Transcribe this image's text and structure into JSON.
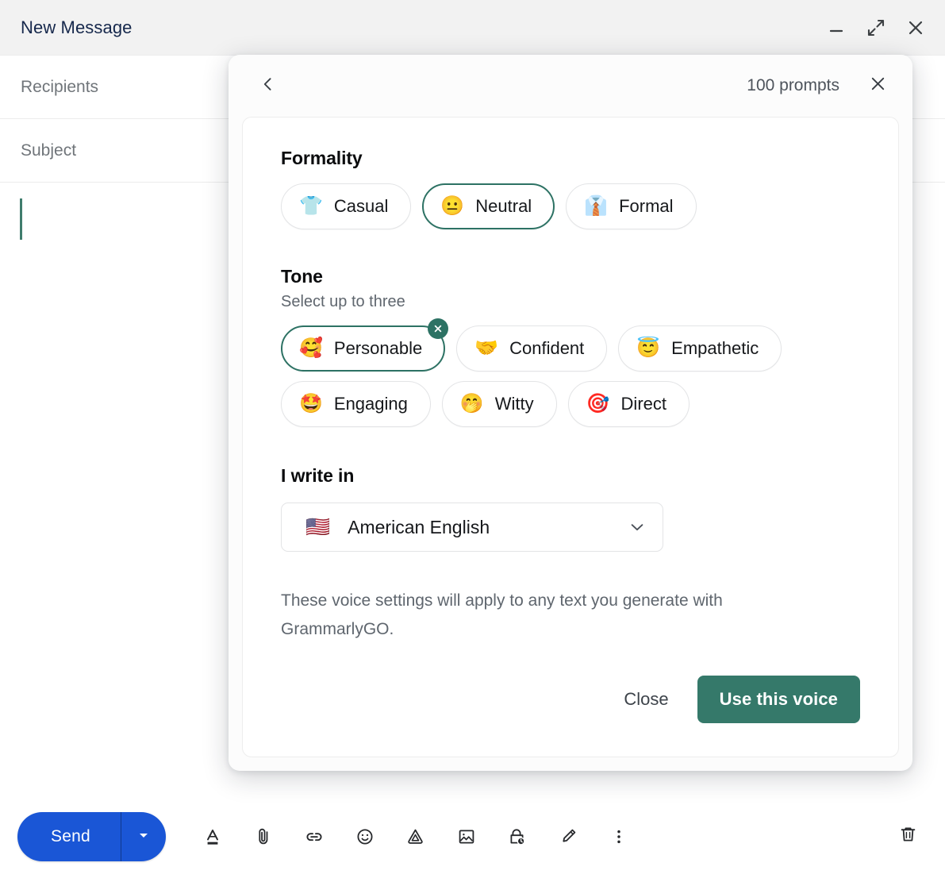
{
  "compose": {
    "title": "New Message",
    "window_controls": [
      {
        "name": "minimize",
        "icon": "minimize-icon"
      },
      {
        "name": "expand",
        "icon": "expand-icon"
      },
      {
        "name": "close",
        "icon": "close-icon"
      }
    ],
    "recipients_placeholder": "Recipients",
    "subject_placeholder": "Subject",
    "body_value": "",
    "toolbar": {
      "send_label": "Send",
      "send_options_icon": "chevron-down-icon",
      "icons": [
        "formatting-options-icon",
        "attach-file-icon",
        "insert-link-icon",
        "insert-emoji-icon",
        "insert-drive-icon",
        "insert-photo-icon",
        "confidential-mode-icon",
        "insert-signature-icon",
        "more-options-icon"
      ],
      "trash_icon": "discard-draft-icon"
    }
  },
  "voice_modal": {
    "back_icon": "chevron-left-icon",
    "prompts_label": "100 prompts",
    "close_icon": "close-icon",
    "formality": {
      "title": "Formality",
      "options": [
        {
          "label": "Casual",
          "emoji": "👕",
          "selected": false
        },
        {
          "label": "Neutral",
          "emoji": "😐",
          "selected": true
        },
        {
          "label": "Formal",
          "emoji": "👔",
          "selected": false
        }
      ]
    },
    "tone": {
      "title": "Tone",
      "subtitle": "Select up to three",
      "options": [
        {
          "label": "Personable",
          "emoji": "🥰",
          "selected": true,
          "removable": true
        },
        {
          "label": "Confident",
          "emoji": "🤝",
          "selected": false,
          "removable": false
        },
        {
          "label": "Empathetic",
          "emoji": "😇",
          "selected": false,
          "removable": false
        },
        {
          "label": "Engaging",
          "emoji": "🤩",
          "selected": false,
          "removable": false
        },
        {
          "label": "Witty",
          "emoji": "🤭",
          "selected": false,
          "removable": false
        },
        {
          "label": "Direct",
          "emoji": "🎯",
          "selected": false,
          "removable": false
        }
      ]
    },
    "language": {
      "title": "I write in",
      "selected_flag": "🇺🇸",
      "selected_label": "American English",
      "chevron_icon": "chevron-down-icon"
    },
    "note": "These voice settings will apply to any text you generate with GrammarlyGO.",
    "close_button": "Close",
    "primary_button": "Use this voice"
  },
  "colors": {
    "accent_teal": "#2d7264",
    "primary_button": "#35796a",
    "send_blue": "#1a56d6",
    "title_navy": "#16284c"
  }
}
